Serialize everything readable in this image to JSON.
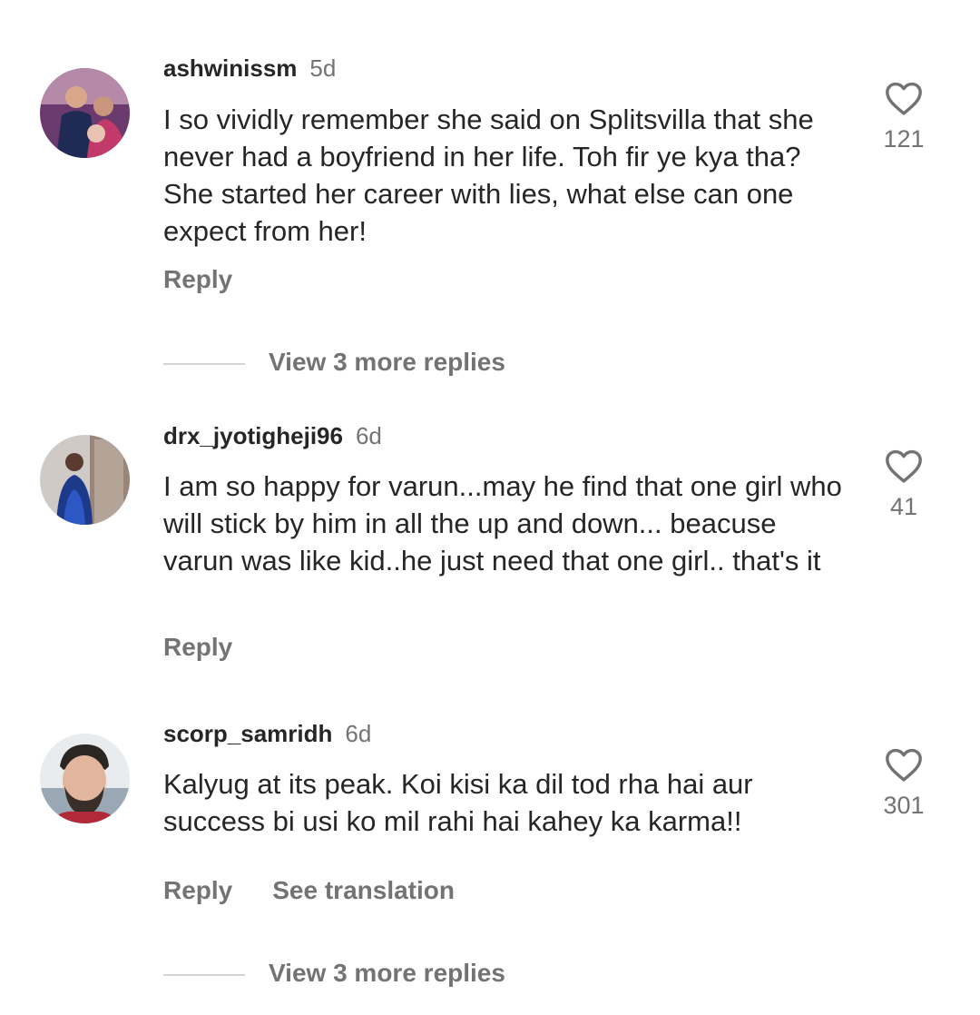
{
  "comments": [
    {
      "username": "ashwinissm",
      "time": "5d",
      "text": "I so vividly remember she said on Splitsvilla that she never had a boyfriend in her life. Toh fir ye kya tha? She started her career with lies, what else can one expect from her!",
      "likes": "121",
      "reply_label": "Reply",
      "view_replies": "View 3 more replies"
    },
    {
      "username": "drx_jyotigheji96",
      "time": "6d",
      "text": "I am so happy for varun...may he find that one girl who will stick by him in all the up and down... beacuse varun was like kid..he just need that one girl.. that's it",
      "likes": "41",
      "reply_label": "Reply"
    },
    {
      "username": "scorp_samridh",
      "time": "6d",
      "text": "Kalyug at its peak. Koi kisi ka dil tod rha hai aur success bi usi ko mil rahi hai kahey ka karma!!",
      "likes": "301",
      "reply_label": "Reply",
      "translate_label": "See translation",
      "view_replies": "View 3 more replies"
    }
  ],
  "icons": {
    "like": "heart-outline-icon"
  },
  "colors": {
    "primary_text": "#262626",
    "secondary_text": "#737373",
    "divider": "#d4d4d4"
  }
}
